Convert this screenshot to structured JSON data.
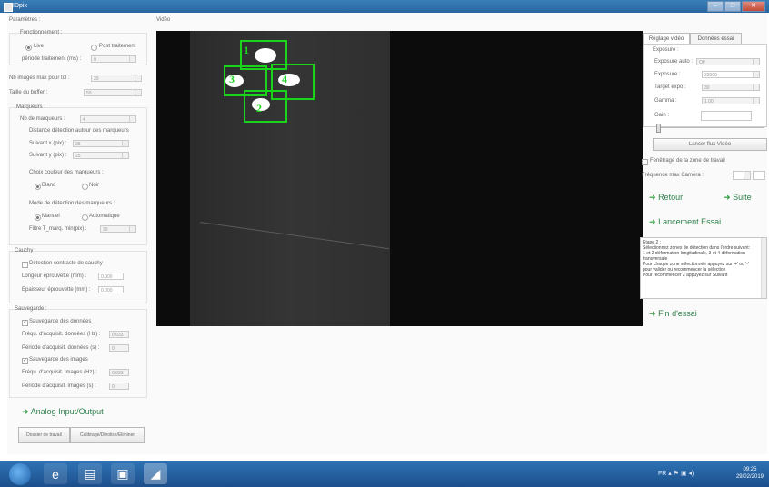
{
  "window": {
    "title": "IDpix",
    "min": "–",
    "max": "□",
    "close": "✕"
  },
  "left": {
    "parametres": "Paramètres :",
    "fonctionnement": "Fonctionnement :",
    "radio_live": "Live",
    "radio_post": "Post traitement",
    "periode_label": "période traitement (ms) :",
    "periode_value": "0",
    "nb_images_label": "Nb images max pour tol :",
    "nb_images_value": "20",
    "taille_buffer_label": "Taille du buffer :",
    "taille_buffer_value": "50",
    "marqueurs": "Marqueurs :",
    "nb_marqueurs_label": "Nb de marqueurs :",
    "nb_marqueurs_value": "4",
    "distance_title": "Distance détection autour des marqueurs",
    "suivant_x_label": "Suivant x (pix) :",
    "suivant_x_value": "25",
    "suivant_y_label": "Suivant y (pix) :",
    "suivant_y_value": "25",
    "choix_couleur": "Choix couleur des marqueurs :",
    "radio_blanc": "Blanc",
    "radio_noir": "Noir",
    "mode_detection": "Mode de détection des marqueurs :",
    "radio_manuel": "Manuel",
    "radio_auto": "Automatique",
    "filtre_label": "Filtre T_marq. min(pix) :",
    "filtre_value": "30",
    "cauchy": "Cauchy :",
    "cauchy_check": "Détection contraste de cauchy",
    "longueur_label": "Longeur éprouvette (mm) :",
    "longueur_value": "0.000",
    "epaisseur_label": "Epaisseur éprouvette (mm) :",
    "epaisseur_value": "0.000",
    "sauvegarde": "Sauvegarde :",
    "save_donnees": "Sauvegarde des données",
    "freq_donnees_label": "Fréqu. d'acquisit. données (Hz) :",
    "freq_donnees_value": "0.033",
    "periode_donnees_label": "Période d'acquisit. données (s) :",
    "periode_donnees_value": "0",
    "save_images": "Sauvegarde des images",
    "freq_images_label": "Fréqu. d'acquisit. images (Hz) :",
    "freq_images_value": "0.033",
    "periode_images_label": "Période d'acquisit. images (s) :",
    "periode_images_value": "0",
    "analog": "Analog Input/Output",
    "btn_dossier": "Dossier de travail",
    "btn_calibrage": "Calibrage/Dinolise/Eliminer"
  },
  "video": {
    "label": "Vidéo",
    "markers": [
      "1",
      "2",
      "3",
      "4"
    ]
  },
  "right": {
    "tab_reglage": "Réglage vidéo",
    "tab_donnees": "Données essai",
    "exposure_title": "Exposure :",
    "exposure_auto_label": "Exposure auto :",
    "exposure_auto_value": "Off",
    "exposure_label": "Exposure :",
    "exposure_value": "33000",
    "target_label": "Target expo :",
    "target_value": "30",
    "gamma_label": "Gamma :",
    "gamma_value": "1.00",
    "gain_label": "Gain :",
    "gain_value": "",
    "btn_lancer_flux": "Lancer flux Vidéo",
    "fenetrage": "Fenêtrage de la zone de travail",
    "frequence_label": "Fréquence max Caméra :",
    "retour": "Retour",
    "suite": "Suite",
    "lancement": "Lancement Essai",
    "log": "Etape 2 :\nSélectionnez zones de détection dans l'ordre suivant:\n1 et 2 déformation longitudinale, 3 et 4 déformation transversale\nPour chaque zone sélectionnée appuyez sur '+' ou '-' pour valider ou recommencer la sélection\nPour recommencer 2 appuyez sur Suivant",
    "fin": "Fin d'essai"
  },
  "taskbar": {
    "lang": "FR",
    "time": "09:25",
    "date": "29/02/2019"
  }
}
